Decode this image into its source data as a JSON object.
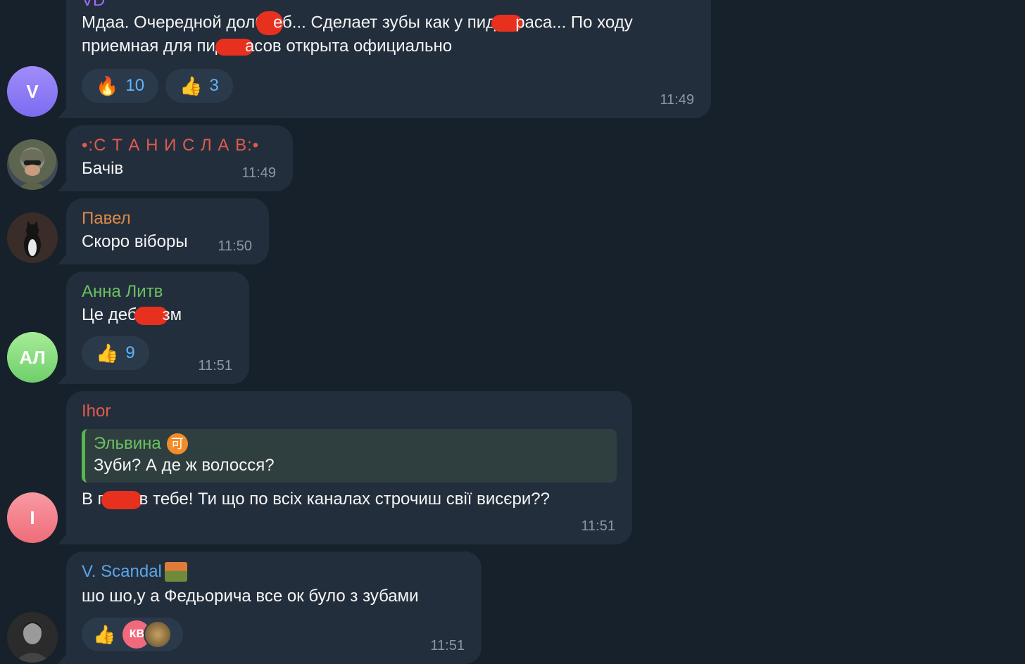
{
  "messages": [
    {
      "sender": "VD",
      "avatar_letter": "V",
      "line1_a": "Мдаа. Очередной долб",
      "line1_b": "еб... Сделает зубы как у пид",
      "line1_c": "раса... По ходу",
      "line2_a": "приемная для пид",
      "line2_b": "асов открыта официально",
      "reactions": [
        {
          "emoji": "🔥",
          "count": "10"
        },
        {
          "emoji": "👍",
          "count": "3"
        }
      ],
      "time": "11:49"
    },
    {
      "sender": "•:С Т А Н И С Л А В:•",
      "text": "Бачів",
      "time": "11:49"
    },
    {
      "sender": "Павел",
      "text": "Скоро віборы",
      "time": "11:50"
    },
    {
      "sender": "Анна Литв",
      "avatar_letter": "АЛ",
      "text_a": "Це деб",
      "text_b": "зм",
      "reactions": [
        {
          "emoji": "👍",
          "count": "9"
        }
      ],
      "time": "11:51"
    },
    {
      "sender": "Ihor",
      "avatar_letter": "I",
      "quote_name": "Эльвина",
      "quote_badge": "可",
      "quote_text": "Зуби? А де ж волосся?",
      "text_a": "В п",
      "text_b": "в тебе! Ти що по всіх каналах строчиш свії висєри??",
      "time": "11:51"
    },
    {
      "sender": "V. Scandal",
      "text": "шо шо,у а Федьорича все ок було з зубами",
      "reaction_emoji": "👍",
      "reaction_avatar": "КВ",
      "time": "11:51"
    }
  ],
  "colors": {
    "background": "#17212b",
    "bubble": "#232e3c",
    "name_vd": "#9b6ef0",
    "name_stanislav": "#e05a4f",
    "name_pavel": "#e08a45",
    "name_anna": "#6ac25f",
    "name_ihor": "#e05a4f",
    "name_scandal": "#5aa5e8",
    "avatar_v": "#8b7cf6",
    "avatar_al": "#7ed67a",
    "avatar_i": "#f26d7d",
    "redaction": "#e8301f"
  }
}
